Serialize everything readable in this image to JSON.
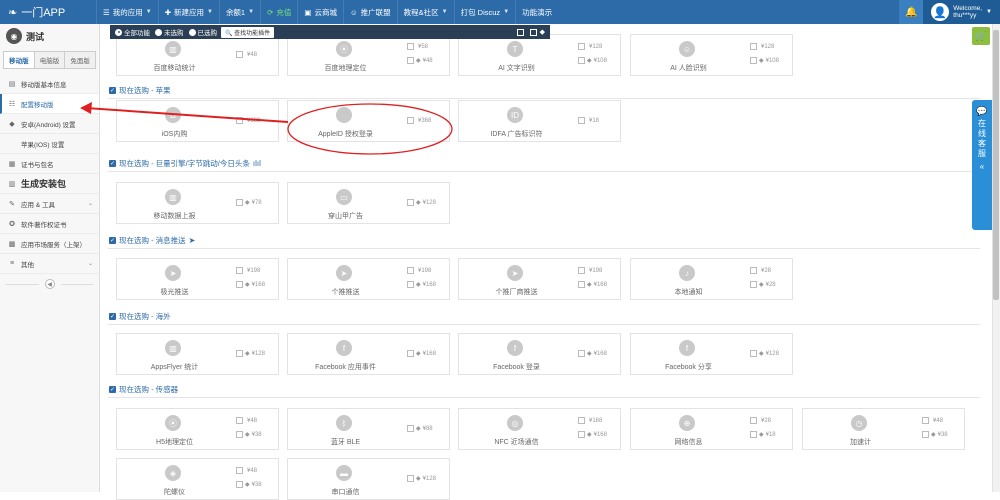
{
  "app": {
    "logo_text": "一门APP"
  },
  "topnav": [
    {
      "label": "我的应用",
      "icon": "menu-icon",
      "caret": true
    },
    {
      "label": "新建应用",
      "icon": "plus-icon",
      "caret": true
    },
    {
      "label": "余额1",
      "icon": "",
      "caret": true
    },
    {
      "label": "充值",
      "icon": "refresh-icon",
      "caret": false,
      "green": true
    },
    {
      "label": "云商城",
      "icon": "store-icon",
      "caret": false
    },
    {
      "label": "推广联盟",
      "icon": "people-icon",
      "caret": false
    },
    {
      "label": "教程&社区",
      "icon": "",
      "caret": true
    },
    {
      "label": "打包 Discuz",
      "icon": "",
      "caret": true
    },
    {
      "label": "功能演示",
      "icon": "",
      "caret": false
    }
  ],
  "user": {
    "welcome": "Welcome,",
    "name": "thu***yy"
  },
  "sidebar": {
    "app_name": "测试",
    "tabs": [
      {
        "label": "移动版",
        "active": true
      },
      {
        "label": "电脑版",
        "active": false
      },
      {
        "label": "免面版",
        "active": false
      }
    ],
    "items": [
      {
        "label": "移动版基本信息",
        "icon": "doc-icon",
        "type": "item"
      },
      {
        "label": "配置移动版",
        "icon": "sliders-icon",
        "type": "item",
        "active": true
      },
      {
        "label": "安卓(Android) 设置",
        "icon": "android-icon",
        "type": "item"
      },
      {
        "label": "苹果(IOS) 设置",
        "icon": "apple-icon",
        "type": "item"
      },
      {
        "label": "证书与包名",
        "icon": "certificate-icon",
        "type": "item"
      },
      {
        "label": "生成安装包",
        "icon": "package-icon",
        "type": "group"
      },
      {
        "label": "应用 & 工具",
        "icon": "tools-icon",
        "type": "item",
        "chev": true
      },
      {
        "label": "软件著作权证书",
        "icon": "award-icon",
        "type": "item"
      },
      {
        "label": "应用市场服务（上架）",
        "icon": "market-icon",
        "type": "item"
      },
      {
        "label": "其他",
        "icon": "list-icon",
        "type": "item",
        "chev": true
      }
    ]
  },
  "filter": {
    "options": [
      {
        "label": "全部功能",
        "checked": true
      },
      {
        "label": "未选购",
        "checked": false
      },
      {
        "label": "已选购",
        "checked": false
      }
    ],
    "find_button": "查找功能插件"
  },
  "sections": [
    {
      "title": "",
      "cards": [
        {
          "name": "百度移动统计",
          "icon": "chart-icon",
          "prices": [
            {
              "os": "apple",
              "price": "¥48"
            }
          ]
        },
        {
          "name": "百度地理定位",
          "icon": "location-icon",
          "prices": [
            {
              "os": "apple",
              "price": "¥58"
            },
            {
              "os": "android",
              "price": "¥48"
            }
          ]
        },
        {
          "name": "AI 文字识别",
          "icon": "text-icon",
          "prices": [
            {
              "os": "apple",
              "price": "¥128"
            },
            {
              "os": "android",
              "price": "¥108"
            }
          ]
        },
        {
          "name": "AI 人脸识别",
          "icon": "face-icon",
          "prices": [
            {
              "os": "apple",
              "price": "¥128"
            },
            {
              "os": "android",
              "price": "¥108"
            }
          ]
        }
      ]
    },
    {
      "title": "现在选购 - 苹果",
      "head_icon": "apple-icon",
      "cards": [
        {
          "name": "iOS内购",
          "icon": "bag-icon",
          "prices": [
            {
              "os": "apple",
              "price": "¥688"
            }
          ]
        },
        {
          "name": "AppleID 授权登录",
          "icon": "apple-icon",
          "prices": [
            {
              "os": "apple",
              "price": "¥368"
            }
          ]
        },
        {
          "name": "IDFA 广告标识符",
          "icon": "idfa-icon",
          "prices": [
            {
              "os": "apple",
              "price": "¥18"
            }
          ]
        }
      ]
    },
    {
      "title": "现在选购 - 巨量引擎/字节跳动/今日头条",
      "head_icon": "bars-icon",
      "cards": [
        {
          "name": "移动数据上报",
          "icon": "chart-icon",
          "prices": [
            {
              "os": "android",
              "price": "¥78"
            }
          ]
        },
        {
          "name": "穿山甲广告",
          "icon": "ad-icon",
          "prices": [
            {
              "os": "android",
              "price": "¥128"
            }
          ]
        }
      ]
    },
    {
      "title": "现在选购 - 消息推送",
      "head_icon": "send-icon",
      "cards": [
        {
          "name": "极光推送",
          "icon": "send-icon",
          "prices": [
            {
              "os": "apple",
              "price": "¥198"
            },
            {
              "os": "android",
              "price": "¥168"
            }
          ]
        },
        {
          "name": "个推推送",
          "icon": "send-icon",
          "prices": [
            {
              "os": "apple",
              "price": "¥198"
            },
            {
              "os": "android",
              "price": "¥168"
            }
          ]
        },
        {
          "name": "个推厂商推送",
          "icon": "send-icon",
          "prices": [
            {
              "os": "apple",
              "price": "¥198"
            },
            {
              "os": "android",
              "price": "¥168"
            }
          ]
        },
        {
          "name": "本地通知",
          "icon": "bell-icon",
          "prices": [
            {
              "os": "apple",
              "price": "¥28"
            },
            {
              "os": "android",
              "price": "¥28"
            }
          ]
        }
      ]
    },
    {
      "title": "现在选购 - 海外",
      "cards": [
        {
          "name": "AppsFlyer 统计",
          "icon": "chart-icon",
          "prices": [
            {
              "os": "android",
              "price": "¥128"
            }
          ]
        },
        {
          "name": "Facebook 应用事件",
          "icon": "facebook-icon",
          "prices": [
            {
              "os": "android",
              "price": "¥168"
            }
          ]
        },
        {
          "name": "Facebook 登录",
          "icon": "facebook-icon",
          "prices": [
            {
              "os": "android",
              "price": "¥168"
            }
          ]
        },
        {
          "name": "Facebook 分享",
          "icon": "facebook-icon",
          "prices": [
            {
              "os": "android",
              "price": "¥128"
            }
          ]
        }
      ]
    },
    {
      "title": "现在选购 - 传感器",
      "cards": [
        {
          "name": "H5地理定位",
          "icon": "location-icon",
          "prices": [
            {
              "os": "apple",
              "price": "¥48"
            },
            {
              "os": "android",
              "price": "¥38"
            }
          ]
        },
        {
          "name": "蓝牙 BLE",
          "icon": "bluetooth-icon",
          "prices": [
            {
              "os": "android",
              "price": "¥88"
            }
          ]
        },
        {
          "name": "NFC 近场通信",
          "icon": "nfc-icon",
          "prices": [
            {
              "os": "apple",
              "price": "¥168"
            },
            {
              "os": "android",
              "price": "¥168"
            }
          ]
        },
        {
          "name": "网络信息",
          "icon": "network-icon",
          "prices": [
            {
              "os": "apple",
              "price": "¥28"
            },
            {
              "os": "android",
              "price": "¥18"
            }
          ]
        },
        {
          "name": "加速计",
          "icon": "gauge-icon",
          "prices": [
            {
              "os": "apple",
              "price": "¥48"
            },
            {
              "os": "android",
              "price": "¥38"
            }
          ]
        },
        {
          "name": "陀螺仪",
          "icon": "gyro-icon",
          "prices": [
            {
              "os": "apple",
              "price": "¥48"
            },
            {
              "os": "android",
              "price": "¥38"
            }
          ]
        },
        {
          "name": "串口通信",
          "icon": "chat-icon",
          "prices": [
            {
              "os": "android",
              "price": "¥128"
            }
          ]
        }
      ]
    }
  ],
  "support": {
    "label": "在线客服",
    "chevron": "«"
  },
  "colors": {
    "topbar": "#2c6aa8",
    "accent": "#2c6aa8",
    "annotation": "#e02020",
    "support": "#2b8fd8",
    "cart": "#8cbf3f"
  }
}
